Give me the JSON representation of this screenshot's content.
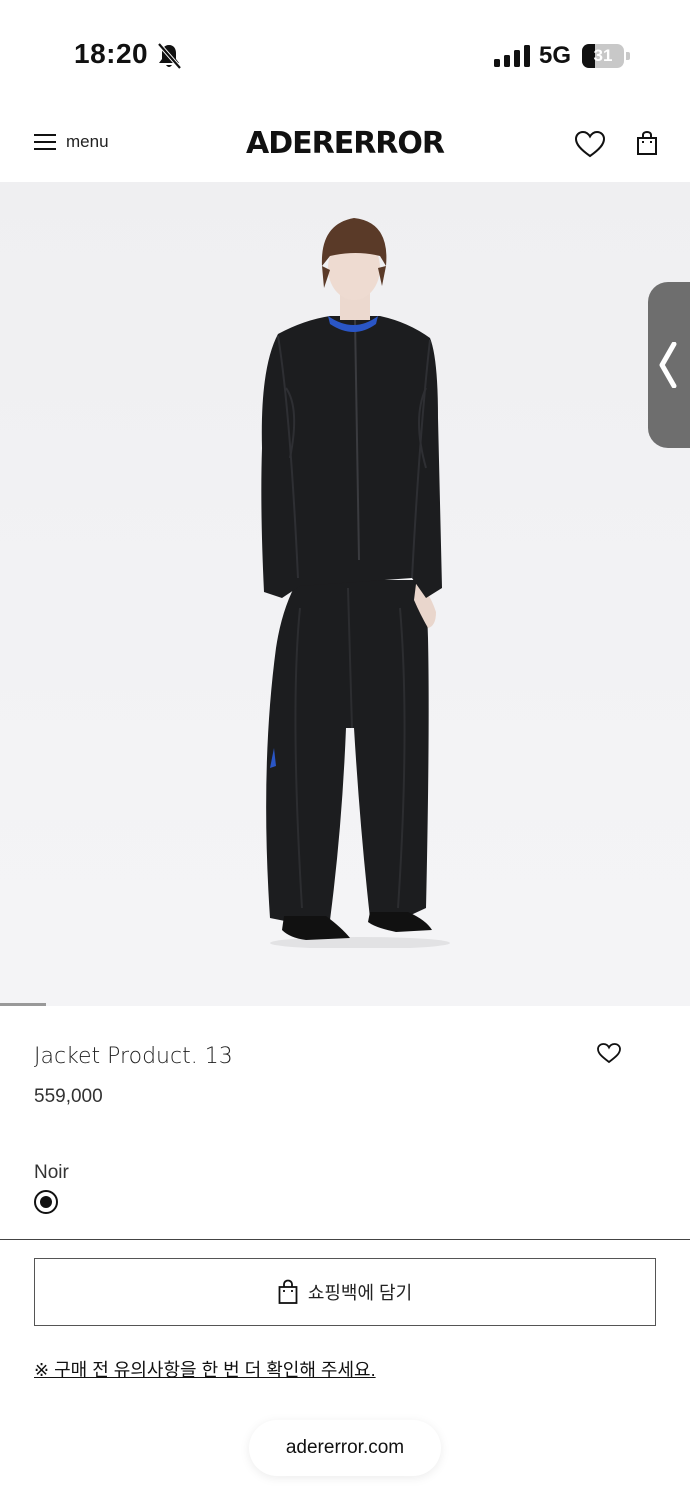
{
  "status_bar": {
    "time": "18:20",
    "network": "5G",
    "battery": "31",
    "battery_level": 0.31
  },
  "header": {
    "menu_label": "menu",
    "logo": "ADERERROR"
  },
  "product": {
    "name": "Jacket Product. 13",
    "price": "559,000",
    "color_label": "Noir",
    "color_selected": true,
    "add_to_bag_label": "쇼핑백에 담기",
    "notice": "※ 구매 전 유의사항을 한 번 더 확인해 주세요."
  },
  "footer": {
    "url": "adererror.com"
  },
  "colors": {
    "jacket": "#1c1d1f",
    "collar_accent": "#2a56c6",
    "background": "#f1f1f3"
  }
}
